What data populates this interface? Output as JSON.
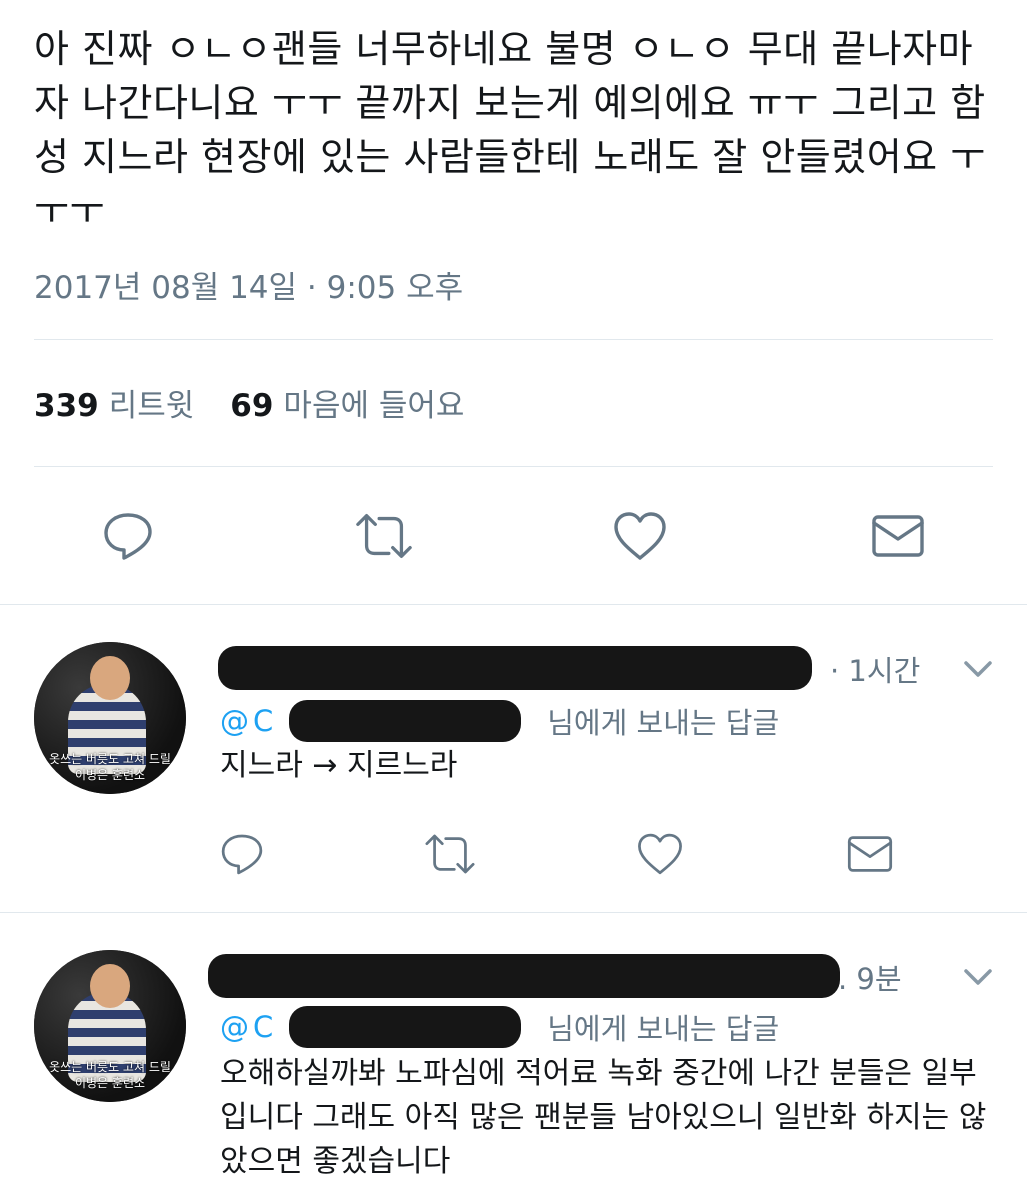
{
  "tweet": {
    "text": "아 진짜 ㅇㄴㅇ괜들 너무하네요 불명 ㅇㄴㅇ 무대 끝나자마자 나간다니요 ㅜㅜ 끝까지 보는게 예의에요 ㅠㅜ 그리고 함성 지느라 현장에 있는 사람들한테 노래도 잘 안들렸어요 ㅜㅜㅜ",
    "timestamp": "2017년 08월 14일 · 9:05 오후",
    "retweets_count": "339",
    "retweets_label": "리트윗",
    "likes_count": "69",
    "likes_label": "마음에 들어요"
  },
  "actions": {
    "reply_icon": "reply-icon",
    "retweet_icon": "retweet-icon",
    "like_icon": "heart-icon",
    "dm_icon": "mail-icon"
  },
  "replies": [
    {
      "time": "· 1시간",
      "replying_prefix": "@",
      "replying_handle": "C",
      "replying_suffix": "님에게 보내는 답글",
      "text": "지느라 → 지르느라",
      "avatar_caption_1": "옷쓰는 버릇도 고쳐 드릴",
      "avatar_caption_2": "이병은 훈련소"
    },
    {
      "time": ". 9분",
      "replying_prefix": "@",
      "replying_handle": "C",
      "replying_suffix": "님에게 보내는 답글",
      "text": "오해하실까봐 노파심에 적어료 녹화 중간에 나간 분들은 일부입니다 그래도 아직 많은 팬분들 남아있으니 일반화 하지는 않았으면 좋겠습니다",
      "avatar_caption_1": "옷쓰는 버릇도 고쳐 드릴",
      "avatar_caption_2": "이병은 훈련소"
    }
  ],
  "colors": {
    "text": "#14171a",
    "secondary": "#657786",
    "link": "#1da1f2",
    "divider": "#e1e8ed",
    "redaction": "#161616"
  }
}
